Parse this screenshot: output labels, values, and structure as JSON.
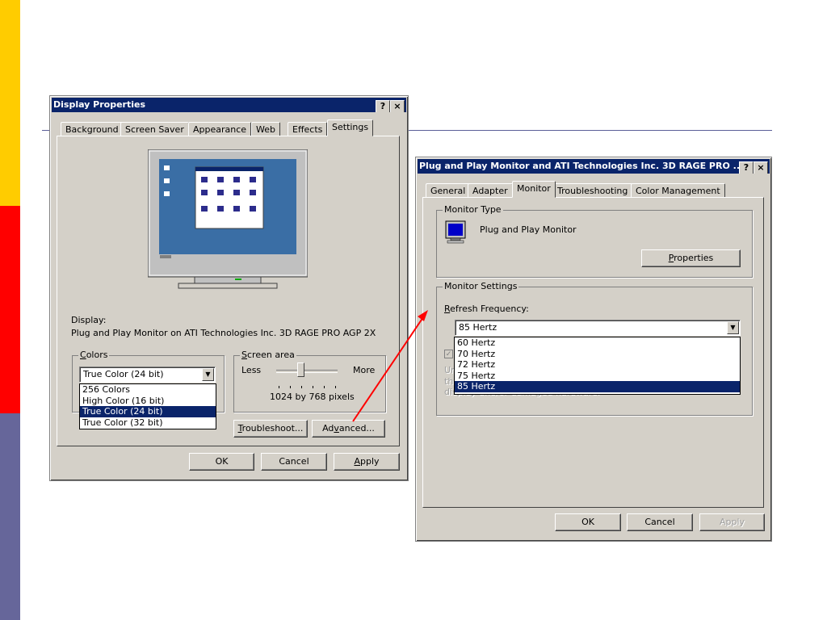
{
  "slide": {
    "bar_colors": [
      "#ffcc00",
      "#ff0000",
      "#66669a"
    ],
    "rule_color": "#5b5f98",
    "arrow_color": "#ff0000"
  },
  "display_properties": {
    "title": "Display Properties",
    "help_button": "?",
    "close_button": "×",
    "tabs": [
      "Background",
      "Screen Saver",
      "Appearance",
      "Web",
      "Effects",
      "Settings"
    ],
    "active_tab": "Settings",
    "display_label": "Display:",
    "display_value": "Plug and Play Monitor on ATI Technologies Inc. 3D RAGE PRO AGP 2X",
    "colors": {
      "accel": "C",
      "label_rest": "olors",
      "selected": "True Color (24 bit)",
      "options": [
        "256 Colors",
        "High Color (16 bit)",
        "True Color (24 bit)",
        "True Color (32 bit)"
      ]
    },
    "screen_area": {
      "accel": "S",
      "label_rest": "creen area",
      "less": "Less",
      "more": "More",
      "value": "1024 by 768 pixels"
    },
    "troubleshoot": {
      "accel": "T",
      "rest": "roubleshoot..."
    },
    "advanced": {
      "pre": "Ad",
      "accel": "v",
      "rest": "anced..."
    },
    "ok": "OK",
    "cancel": "Cancel",
    "apply": {
      "accel": "A",
      "rest": "pply"
    }
  },
  "monitor_properties": {
    "title": "Plug and Play Monitor and ATI Technologies Inc. 3D RAGE PRO ...",
    "help_button": "?",
    "close_button": "×",
    "tabs": [
      "General",
      "Adapter",
      "Monitor",
      "Troubleshooting",
      "Color Management"
    ],
    "active_tab": "Monitor",
    "monitor_type": {
      "label": "Monitor Type",
      "name": "Plug and Play Monitor",
      "properties": {
        "accel": "P",
        "rest": "roperties"
      }
    },
    "monitor_settings": {
      "label": "Monitor Settings",
      "refresh": {
        "accel": "R",
        "rest": "efresh Frequency:"
      },
      "selected": "85 Hertz",
      "options": [
        "60 Hertz",
        "70 Hertz",
        "72 Hertz",
        "75 Hertz",
        "85 Hertz"
      ],
      "hidden_text_1": "Un",
      "hidden_text_2": "th",
      "hidden_text_3": "display and/or damaged hardware."
    },
    "ok": "OK",
    "cancel": "Cancel",
    "apply": "Apply"
  }
}
